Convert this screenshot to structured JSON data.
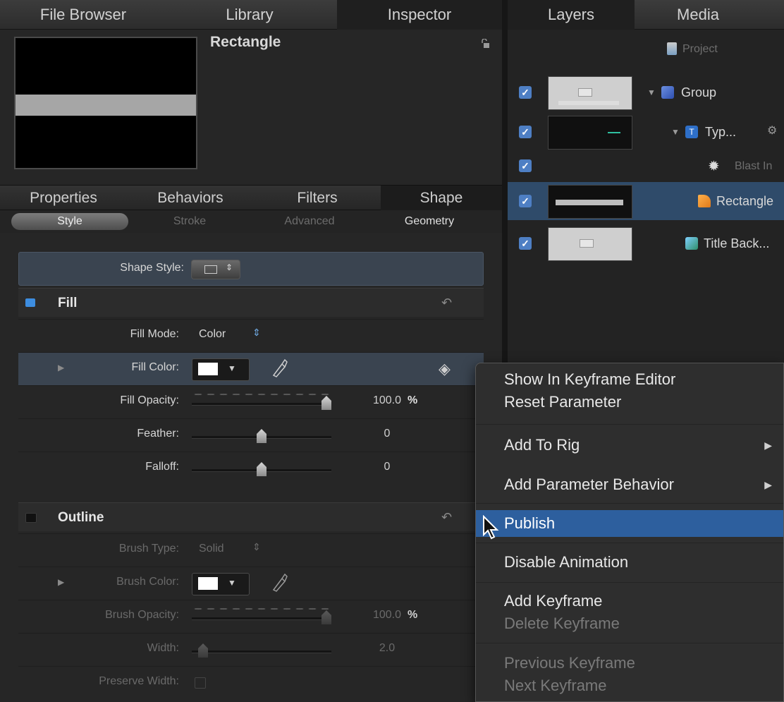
{
  "tabs_left": [
    "File Browser",
    "Library",
    "Inspector"
  ],
  "tabs_right": [
    "Layers",
    "Media"
  ],
  "inspector": {
    "object_title": "Rectangle",
    "subtabs": [
      "Properties",
      "Behaviors",
      "Filters",
      "Shape"
    ],
    "segments": [
      "Style",
      "Stroke",
      "Advanced",
      "Geometry"
    ],
    "shape_style_label": "Shape Style:",
    "fill": {
      "title": "Fill",
      "mode_label": "Fill Mode:",
      "mode_value": "Color",
      "color_label": "Fill Color:",
      "opacity_label": "Fill Opacity:",
      "opacity_value": "100.0",
      "opacity_unit": "%",
      "opacity_level": 1.0,
      "feather_label": "Feather:",
      "feather_value": "0",
      "feather_level": 0.5,
      "falloff_label": "Falloff:",
      "falloff_value": "0",
      "falloff_level": 0.5
    },
    "outline": {
      "title": "Outline",
      "brush_type_label": "Brush Type:",
      "brush_type_value": "Solid",
      "brush_color_label": "Brush Color:",
      "brush_opacity_label": "Brush Opacity:",
      "brush_opacity_value": "100.0",
      "brush_opacity_unit": "%",
      "brush_opacity_level": 1.0,
      "width_label": "Width:",
      "width_value": "2.0",
      "width_level": 0.05,
      "preserve_width_label": "Preserve Width:"
    }
  },
  "layers": {
    "project": "Project",
    "rows": [
      {
        "name": "Group"
      },
      {
        "name": "Typ..."
      },
      {
        "name": "Blast In"
      },
      {
        "name": "Rectangle"
      },
      {
        "name": "Title Back..."
      }
    ]
  },
  "context_menu": {
    "items": [
      "Show In Keyframe Editor",
      "Reset Parameter",
      "Add To Rig",
      "Add Parameter Behavior",
      "Publish",
      "Disable Animation",
      "Add Keyframe",
      "Delete Keyframe",
      "Previous Keyframe",
      "Next Keyframe"
    ]
  },
  "colors": {
    "accent_blue": "#2d5f9e",
    "selected_row": "#2f4b6a",
    "checkbox_blue": "#4e7fc4"
  }
}
